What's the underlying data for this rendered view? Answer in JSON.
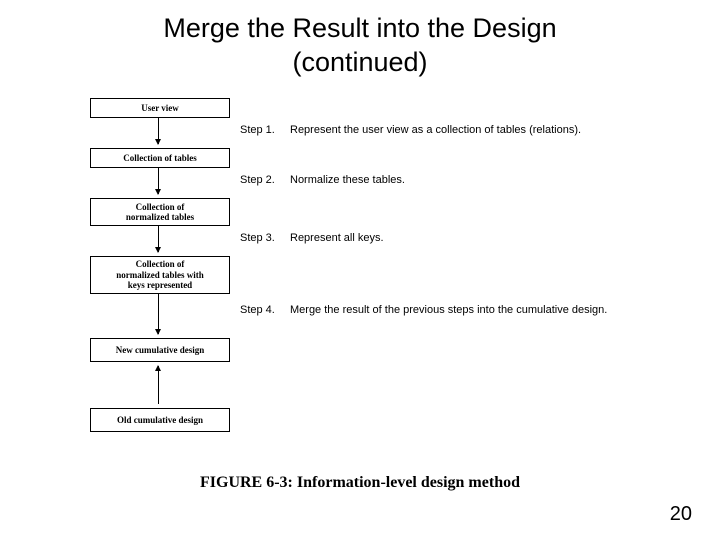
{
  "title_line1": "Merge the Result into the Design",
  "title_line2": "(continued)",
  "boxes": {
    "b1": "User view",
    "b2": "Collection of tables",
    "b3": "Collection of\nnormalized tables",
    "b4": "Collection of\nnormalized tables with\nkeys represented",
    "b5": "New cumulative design",
    "b6": "Old cumulative design"
  },
  "steps": {
    "s1_label": "Step 1.",
    "s1_desc": "Represent the user view as a collection of tables (relations).",
    "s2_label": "Step 2.",
    "s2_desc": "Normalize these tables.",
    "s3_label": "Step 3.",
    "s3_desc": "Represent all keys.",
    "s4_label": "Step 4.",
    "s4_desc": "Merge the result of the previous steps into the cumulative design."
  },
  "caption": "FIGURE 6-3: Information-level design method",
  "page_number": "20"
}
